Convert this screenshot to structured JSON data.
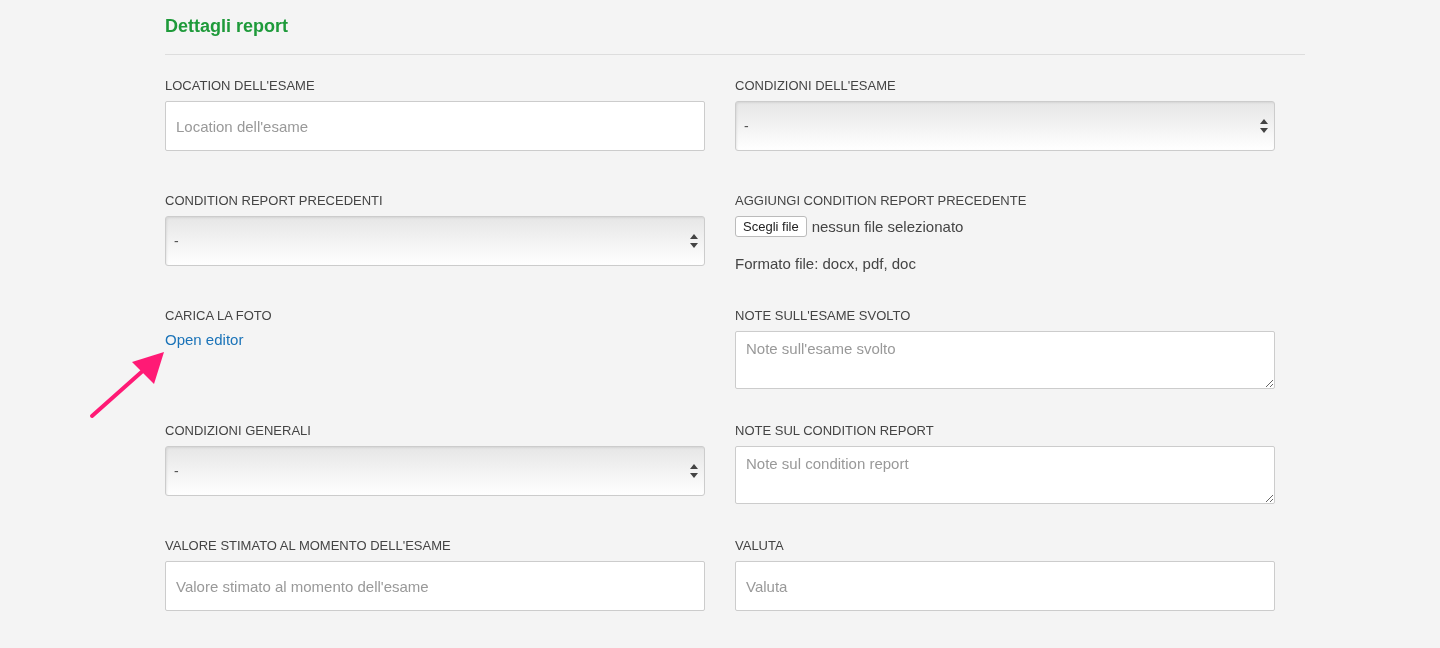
{
  "section": {
    "title": "Dettagli report"
  },
  "fields": [
    {
      "kind": "input",
      "label": "LOCATION DELL'ESAME",
      "placeholder": "Location dell'esame"
    },
    {
      "kind": "select",
      "label": "CONDIZIONI DELL'ESAME",
      "value": "-"
    },
    {
      "kind": "select",
      "label": "CONDITION REPORT PRECEDENTI",
      "value": "-"
    },
    {
      "kind": "file",
      "label": "AGGIUNGI CONDITION REPORT PRECEDENTE",
      "button": "Scegli file",
      "status": "nessun file selezionato",
      "note": "Formato file: docx, pdf, doc"
    },
    {
      "kind": "link",
      "label": "CARICA LA FOTO",
      "link": "Open editor"
    },
    {
      "kind": "textarea",
      "label": "NOTE SULL'ESAME SVOLTO",
      "placeholder": "Note sull'esame svolto"
    },
    {
      "kind": "select",
      "label": "CONDIZIONI GENERALI",
      "value": "-"
    },
    {
      "kind": "textarea",
      "label": "NOTE SUL CONDITION REPORT",
      "placeholder": "Note sul condition report"
    },
    {
      "kind": "input",
      "label": "VALORE STIMATO AL MOMENTO DELL'ESAME",
      "placeholder": "Valore stimato al momento dell'esame"
    },
    {
      "kind": "input",
      "label": "VALUTA",
      "placeholder": "Valuta"
    }
  ]
}
